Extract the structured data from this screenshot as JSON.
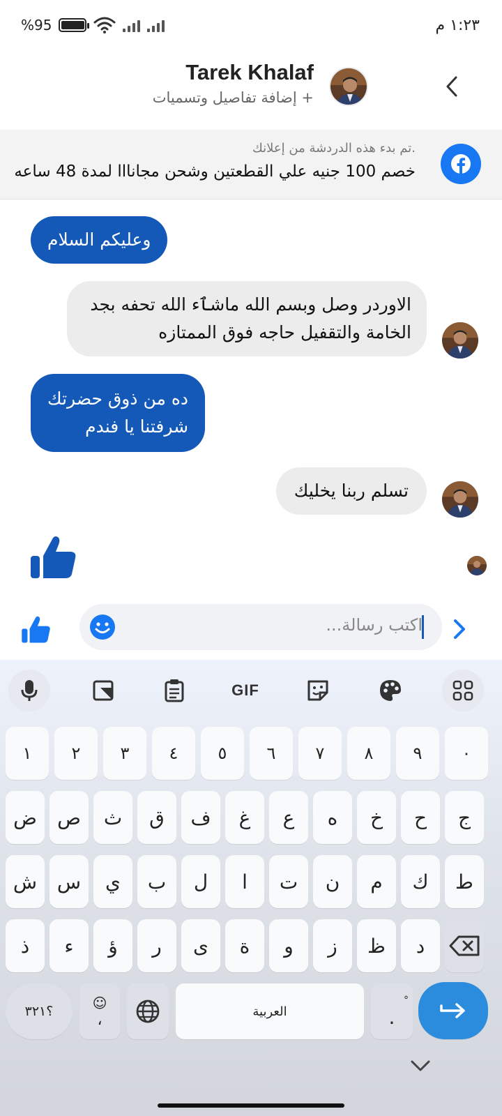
{
  "status_bar": {
    "time": "١:٢٣ م",
    "battery_percent": "%95",
    "battery_level": 0.95
  },
  "header": {
    "contact_name": "Tarek Khalaf",
    "subtitle": "+ إضافة تفاصيل وتسميات"
  },
  "ad_banner": {
    "note": ".تم بدء هذه الدردشة من إعلانك",
    "title": "خصم 100 جنيه علي القطعتين وشحن مجانااا لمدة 48 ساعه"
  },
  "messages": [
    {
      "direction": "sent",
      "text": "وعليكم السلام"
    },
    {
      "direction": "received",
      "line1": "الاوردر وصل وبسم الله ماشٱء الله تحفه بجد",
      "line2": "الخامة والتقفيل حاجه فوق الممتازه"
    },
    {
      "direction": "sent",
      "line1": "ده من ذوق حضرتك",
      "line2": "شرفتنا يا فندم"
    },
    {
      "direction": "received",
      "text": "تسلم  ربنا يخليك"
    },
    {
      "direction": "sent",
      "sticker": "thumbs-up-icon"
    }
  ],
  "composer": {
    "placeholder": "اكتب رسالة..."
  },
  "keyboard": {
    "number_row": [
      "١",
      "٢",
      "٣",
      "٤",
      "٥",
      "٦",
      "٧",
      "٨",
      "٩",
      "٠"
    ],
    "row1": [
      "ض",
      "ص",
      "ث",
      "ق",
      "ف",
      "غ",
      "ع",
      "ه",
      "خ",
      "ح",
      "ج"
    ],
    "row2": [
      "ش",
      "س",
      "ي",
      "ب",
      "ل",
      "ا",
      "ت",
      "ن",
      "م",
      "ك",
      "ط"
    ],
    "row3": [
      "ذ",
      "ء",
      "ؤ",
      "ر",
      "ى",
      "ة",
      "و",
      "ز",
      "ظ",
      "د"
    ],
    "symbols_label": "؟٣٢١",
    "comma": "،",
    "space_label": "العربية",
    "period": "."
  },
  "colors": {
    "accent": "#1458b8",
    "facebook": "#1877f2",
    "received_bubble": "#ececec",
    "enter_key": "#2b8cde"
  }
}
